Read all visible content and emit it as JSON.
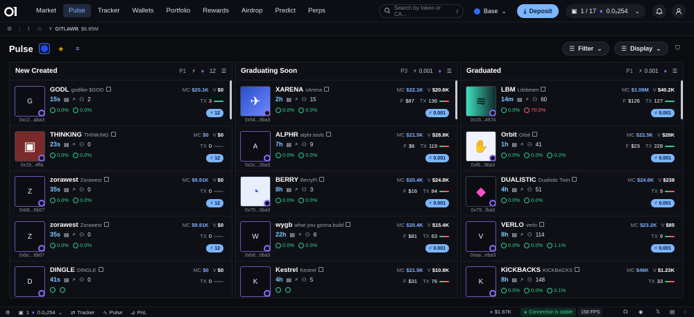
{
  "nav": [
    "Market",
    "Pulse",
    "Tracker",
    "Wallets",
    "Portfolio",
    "Rewards",
    "Airdrop",
    "Predict",
    "Perps"
  ],
  "nav_active": "Pulse",
  "search": {
    "placeholder": "Search by token or CA...",
    "shortcut": "/"
  },
  "chain": "Base",
  "deposit": "Deposit",
  "wallet": {
    "count": "1 / 17",
    "balance": "0.0₂254"
  },
  "subbar": {
    "ticker": "Y",
    "name": "GITLAWB",
    "mc": "$6.85M"
  },
  "pulse": {
    "title": "Pulse",
    "filter": "Filter",
    "display": "Display"
  },
  "columns": [
    {
      "title": "New Created",
      "preset": "P1",
      "amount": "12",
      "cards": [
        {
          "letter": "G",
          "ticker": "GODL",
          "name": "godlike $GOD",
          "addr": "0xc2...aba3",
          "age": "15s",
          "holders": "2",
          "p1": "0.0%",
          "p2": "0.0%",
          "mc": "$20.1K",
          "v": "$0",
          "tx": "3",
          "buy": "12"
        },
        {
          "letter": "",
          "ticker": "THINKING",
          "name": "THINKING",
          "addr": "0x19...4ffa",
          "age": "23s",
          "holders": "0",
          "p1": "0.0%",
          "p2": "0.0%",
          "mc": "$0",
          "v": "$0",
          "tx": "0",
          "buy": "12"
        },
        {
          "letter": "Z",
          "ticker": "zorawest",
          "name": "Zorawest",
          "addr": "0xb6...6b07",
          "age": "35s",
          "holders": "0",
          "p1": "0.0%",
          "p2": "0.0%",
          "mc": "$9.91K",
          "v": "$0",
          "tx": "0",
          "buy": "12"
        },
        {
          "letter": "Z",
          "ticker": "zorawest",
          "name": "Zorawest",
          "addr": "0xbc...6b07",
          "age": "35s",
          "holders": "0",
          "p1": "0.0%",
          "p2": "0.0%",
          "mc": "$9.91K",
          "v": "$0",
          "tx": "0",
          "buy": "12"
        },
        {
          "letter": "D",
          "ticker": "DINGLE",
          "name": "DINGLE",
          "addr": "",
          "age": "41s",
          "holders": "0",
          "p1": "",
          "p2": "",
          "mc": "$0",
          "v": "$0",
          "tx": "0",
          "buy": ""
        }
      ]
    },
    {
      "title": "Graduating Soon",
      "preset": "P3",
      "amount": "0.001",
      "cards": [
        {
          "letter": "",
          "ticker": "XARENA",
          "name": "xArena",
          "addr": "0x54...8ba3",
          "age": "2h",
          "holders": "15",
          "p1": "0.0%",
          "p2": "0.0%",
          "mc": "$22.1K",
          "v": "$20.6K",
          "f": "$87",
          "tx": "136",
          "buy": "0.001"
        },
        {
          "letter": "A",
          "ticker": "ALPHR",
          "name": "alphr.tools",
          "addr": "0x2c...2ba3",
          "age": "7h",
          "holders": "9",
          "p1": "0.0%",
          "p2": "0.0%",
          "mc": "$21.5K",
          "v": "$28.8K",
          "f": "$6",
          "tx": "119",
          "buy": "0.001"
        },
        {
          "letter": "",
          "ticker": "BERRY",
          "name": "BerryFi",
          "addr": "0x70...0ba3",
          "age": "8h",
          "holders": "3",
          "p1": "0.0%",
          "p2": "0.0%",
          "mc": "$20.4K",
          "v": "$24.8K",
          "f": "$16",
          "tx": "84",
          "buy": "0.001"
        },
        {
          "letter": "W",
          "ticker": "wygb",
          "name": "what you gonna build",
          "addr": "0xb8...0ba3",
          "age": "22h",
          "holders": "6",
          "p1": "0.0%",
          "p2": "0.0%",
          "mc": "$20.4K",
          "v": "$15.4K",
          "f": "$81",
          "tx": "63",
          "buy": "0.001"
        },
        {
          "letter": "K",
          "ticker": "Kestrel",
          "name": "Kestrel",
          "addr": "",
          "age": "4h",
          "holders": "5",
          "p1": "",
          "p2": "",
          "mc": "$21.5K",
          "v": "$10.8K",
          "f": "$31",
          "tx": "76",
          "buy": ""
        }
      ]
    },
    {
      "title": "Graduated",
      "preset": "P1",
      "amount": "0.001",
      "cards": [
        {
          "letter": "",
          "ticker": "LBM",
          "name": "Litebeam",
          "addr": "0x15...4974",
          "age": "14m",
          "holders": "60",
          "p1": "0.0%",
          "p2": "70.0%",
          "mc": "$1.09M",
          "v": "$40.2K",
          "f": "$126",
          "tx": "127",
          "buy": "0.001"
        },
        {
          "letter": "",
          "ticker": "Orbit",
          "name": "Orbit",
          "addr": "0xf6...9ba3",
          "age": "1h",
          "holders": "41",
          "p1": "0.0%",
          "p2": "0.0%",
          "p3": "0.2%",
          "mc": "$22.5K",
          "v": "$28K",
          "f": "$23",
          "tx": "228",
          "buy": "0.001"
        },
        {
          "letter": "",
          "ticker": "DUALISTIC",
          "name": "Dualistic Twin",
          "addr": "0x79...fba3",
          "age": "4h",
          "holders": "51",
          "p1": "0.0%",
          "p2": "0.0%",
          "mc": "$24.6K",
          "v": "$238",
          "tx": "9",
          "buy": "0.001"
        },
        {
          "letter": "V",
          "ticker": "VERLO",
          "name": "verlo",
          "addr": "0xaa...eba3",
          "age": "8h",
          "holders": "114",
          "p1": "0.0%",
          "p2": "0.0%",
          "p3": "1.1%",
          "mc": "$23.2K",
          "v": "$85",
          "tx": "9",
          "buy": "0.001"
        },
        {
          "letter": "K",
          "ticker": "KICKBACKS",
          "name": "KICKBACKS",
          "addr": "",
          "age": "8h",
          "holders": "148",
          "p1": "0.0%",
          "p2": "0.0%",
          "p3": "0.1%",
          "mc": "$46K",
          "v": "$1.23K",
          "tx": "33",
          "buy": ""
        }
      ]
    }
  ],
  "footer": {
    "count": "1",
    "balance": "0.0₂254",
    "tracker": "Tracker",
    "pulse": "Pulse",
    "pnl": "PnL",
    "eth_price": "$1.67K",
    "conn": "Connection is stable",
    "fps": "158 FPS"
  }
}
